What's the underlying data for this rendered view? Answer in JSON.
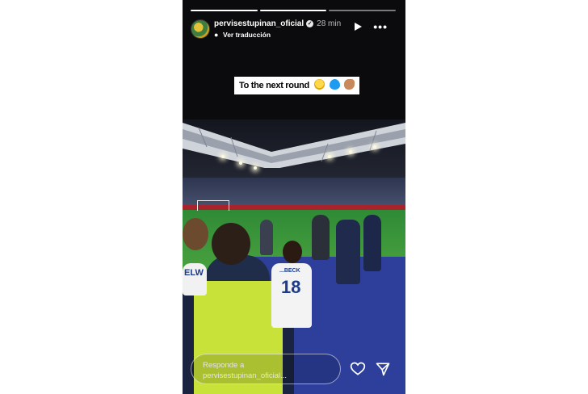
{
  "story": {
    "username": "pervisestupinan_oficial",
    "time_ago": "28 min",
    "translate_label": "Ver traducción",
    "caption_text": "To the next round",
    "caption_emojis": [
      "star-struck-emoji",
      "blue-heart-emoji",
      "flexed-biceps-emoji"
    ],
    "progress_segments": 3,
    "progress_current": 2
  },
  "photo": {
    "jersey_number": "18",
    "jersey_name_right": "...BECK",
    "jersey_name_left": "ELW"
  },
  "reply": {
    "placeholder_line1": "Responde a",
    "placeholder_line2": "pervisestupinan_oficial..."
  },
  "icons": {
    "verified": "verified-badge-icon",
    "play": "play-icon",
    "more": "more-options-icon",
    "like": "heart-icon",
    "send": "send-icon"
  },
  "colors": {
    "bib": "#c8e23a",
    "jersey_blue": "#1c3b8a",
    "pitch_green": "#3e9a3b"
  }
}
